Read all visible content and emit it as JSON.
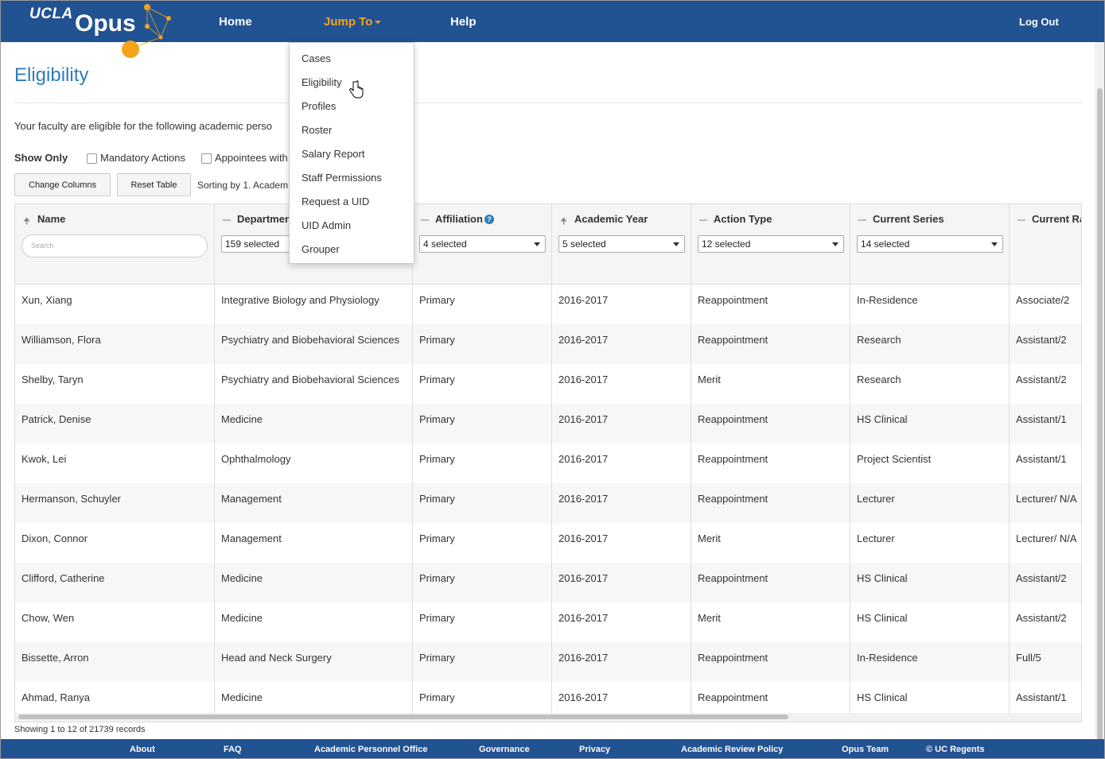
{
  "brand": {
    "ucla": "UCLA",
    "app": "Opus"
  },
  "nav": {
    "home": "Home",
    "jump_to": "Jump To",
    "help": "Help",
    "logout": "Log Out"
  },
  "jump_menu": [
    "Cases",
    "Eligibility",
    "Profiles",
    "Roster",
    "Salary Report",
    "Staff Permissions",
    "Request a UID",
    "UID Admin",
    "Grouper"
  ],
  "page": {
    "title": "Eligibility",
    "intro": "Your faculty are eligible for the following academic perso",
    "show_only": "Show Only",
    "filters": [
      "Mandatory Actions",
      "Appointees with"
    ],
    "change_columns": "Change Columns",
    "reset_table": "Reset Table",
    "sorting": "Sorting by 1. Academ"
  },
  "table": {
    "columns": [
      {
        "label": "Name",
        "sort": "asc",
        "filter": "Search"
      },
      {
        "label": "Departmen",
        "sort": "none",
        "filter": "159 selected"
      },
      {
        "label": "Affiliation",
        "sort": "none",
        "filter": "4 selected"
      },
      {
        "label": "Academic Year",
        "sort": "asc",
        "filter": "5 selected"
      },
      {
        "label": "Action Type",
        "sort": "none",
        "filter": "12 selected"
      },
      {
        "label": "Current Series",
        "sort": "none",
        "filter": "14 selected"
      },
      {
        "label": "Current Ra",
        "sort": "none",
        "filter": ""
      }
    ],
    "rows": [
      [
        "Xun, Xiang",
        "Integrative Biology and Physiology",
        "Primary",
        "2016-2017",
        "Reappointment",
        "In-Residence",
        "Associate/2"
      ],
      [
        "Williamson, Flora",
        "Psychiatry and Biobehavioral Sciences",
        "Primary",
        "2016-2017",
        "Reappointment",
        "Research",
        "Assistant/2"
      ],
      [
        "Shelby, Taryn",
        "Psychiatry and Biobehavioral Sciences",
        "Primary",
        "2016-2017",
        "Merit",
        "Research",
        "Assistant/2"
      ],
      [
        "Patrick, Denise",
        "Medicine",
        "Primary",
        "2016-2017",
        "Reappointment",
        "HS Clinical",
        "Assistant/1"
      ],
      [
        "Kwok, Lei",
        "Ophthalmology",
        "Primary",
        "2016-2017",
        "Reappointment",
        "Project Scientist",
        "Assistant/1"
      ],
      [
        "Hermanson, Schuyler",
        "Management",
        "Primary",
        "2016-2017",
        "Reappointment",
        "Lecturer",
        "Lecturer/ N/A"
      ],
      [
        "Dixon, Connor",
        "Management",
        "Primary",
        "2016-2017",
        "Merit",
        "Lecturer",
        "Lecturer/ N/A"
      ],
      [
        "Clifford, Catherine",
        "Medicine",
        "Primary",
        "2016-2017",
        "Reappointment",
        "HS Clinical",
        "Assistant/2"
      ],
      [
        "Chow, Wen",
        "Medicine",
        "Primary",
        "2016-2017",
        "Merit",
        "HS Clinical",
        "Assistant/2"
      ],
      [
        "Bissette, Arron",
        "Head and Neck Surgery",
        "Primary",
        "2016-2017",
        "Reappointment",
        "In-Residence",
        "Full/5"
      ],
      [
        "Ahmad, Ranya",
        "Medicine",
        "Primary",
        "2016-2017",
        "Reappointment",
        "HS Clinical",
        "Assistant/1"
      ]
    ],
    "showing": "Showing 1 to 12 of 21739 records"
  },
  "footer": [
    "About",
    "FAQ",
    "Academic Personnel Office",
    "Governance",
    "Privacy",
    "Academic Review Policy",
    "Opus Team",
    "© UC Regents"
  ],
  "colors": {
    "nav_bg": "#215291",
    "accent": "#f5a31b",
    "title": "#2f7cb8"
  }
}
